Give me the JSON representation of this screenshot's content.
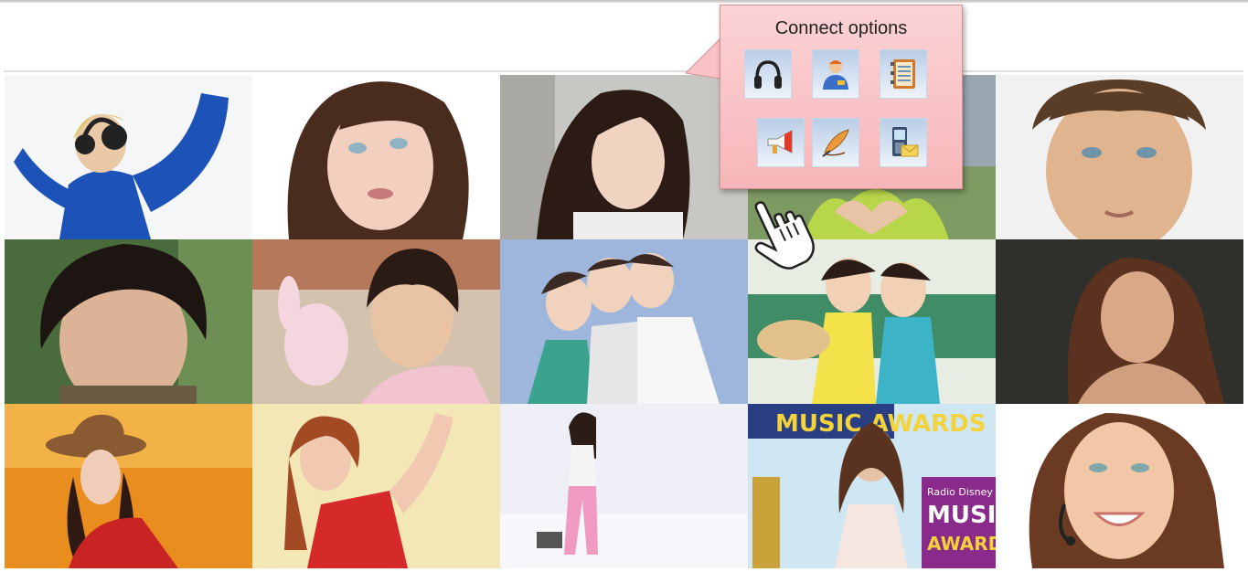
{
  "callout": {
    "title": "Connect options",
    "options": [
      {
        "icon": "headphones-icon"
      },
      {
        "icon": "contact-person-icon"
      },
      {
        "icon": "address-book-icon"
      },
      {
        "icon": "megaphone-icon"
      },
      {
        "icon": "quill-pen-icon"
      },
      {
        "icon": "mobile-mail-icon"
      }
    ]
  },
  "grid": {
    "rows": 3,
    "columns": 5,
    "tiles": [
      {
        "subject": "woman with headphones"
      },
      {
        "subject": "woman looking up"
      },
      {
        "subject": "woman with long dark hair"
      },
      {
        "subject": "hands making heart shape"
      },
      {
        "subject": "man portrait"
      },
      {
        "subject": "man with dark hair"
      },
      {
        "subject": "man holding toy"
      },
      {
        "subject": "three girls"
      },
      {
        "subject": "two girls on bench"
      },
      {
        "subject": "woman with long hair"
      },
      {
        "subject": "woman in hat"
      },
      {
        "subject": "woman in red top"
      },
      {
        "subject": "woman walking"
      },
      {
        "subject": "woman at music awards"
      },
      {
        "subject": "smiling woman with headset"
      }
    ]
  },
  "award_text": {
    "tile14_top": "MUSIC AWARDS",
    "tile14_badge_line1": "Radio Disney",
    "tile14_badge_line2": "MUSIC",
    "tile14_badge_line3": "AWARDS"
  },
  "colors": {
    "callout_bg": "#f9c4c7",
    "button_bg": "#c9d9ee"
  }
}
